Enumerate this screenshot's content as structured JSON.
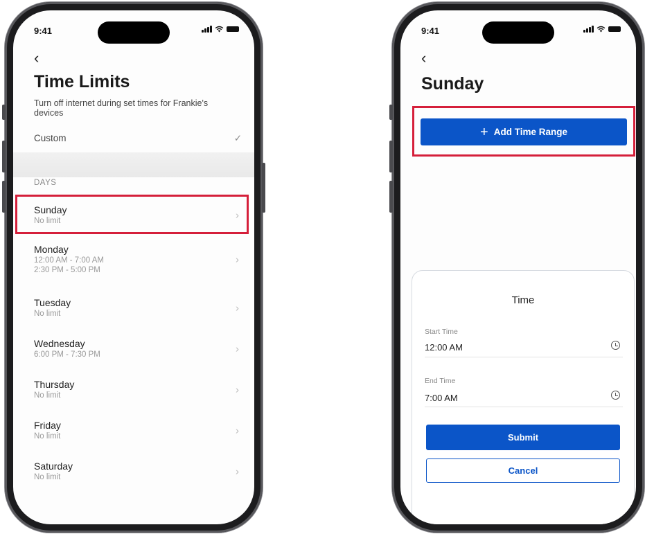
{
  "left": {
    "status_time": "9:41",
    "back_icon": "chevron-left-icon",
    "title": "Time Limits",
    "subtitle": "Turn off internet during set times for Frankie's devices",
    "custom_label": "Custom",
    "check_icon": "checkmark-icon",
    "days_label": "DAYS",
    "days": [
      {
        "name": "Sunday",
        "detail": "No limit"
      },
      {
        "name": "Monday",
        "detail": "12:00 AM - 7:00 AM",
        "detail2": "2:30 PM - 5:00 PM"
      },
      {
        "name": "Tuesday",
        "detail": "No limit"
      },
      {
        "name": "Wednesday",
        "detail": "6:00 PM - 7:30 PM"
      },
      {
        "name": "Thursday",
        "detail": "No limit"
      },
      {
        "name": "Friday",
        "detail": "No limit"
      },
      {
        "name": "Saturday",
        "detail": "No limit"
      }
    ]
  },
  "right": {
    "status_time": "9:41",
    "back_icon": "chevron-left-icon",
    "title": "Sunday",
    "add_button": "Add Time Range",
    "sheet": {
      "title": "Time",
      "start_label": "Start Time",
      "start_value": "12:00 AM",
      "end_label": "End Time",
      "end_value": "7:00 AM",
      "submit": "Submit",
      "cancel": "Cancel"
    }
  },
  "colors": {
    "accent": "#0b55c8",
    "highlight": "#d51f3a"
  }
}
